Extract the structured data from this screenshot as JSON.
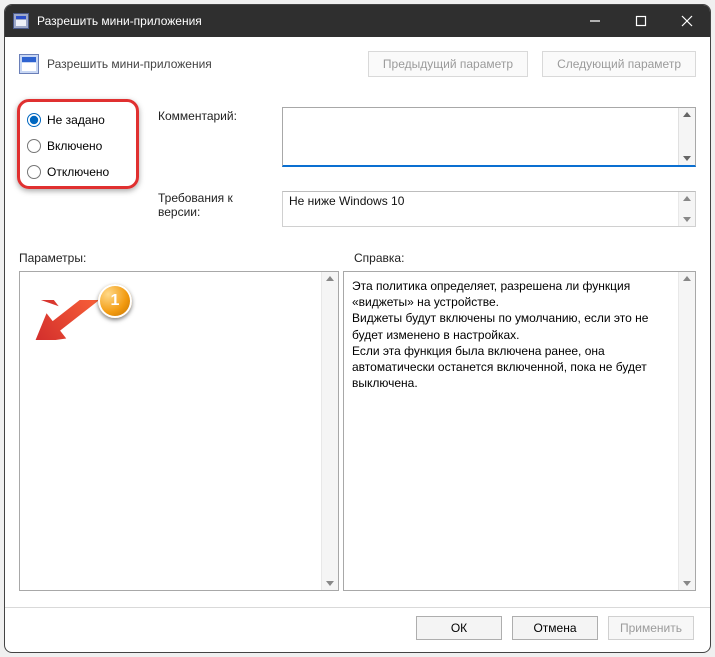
{
  "title": "Разрешить мини-приложения",
  "policyTitle": "Разрешить мини-приложения",
  "nav": {
    "prev": "Предыдущий параметр",
    "next": "Следующий параметр"
  },
  "radios": {
    "notset": "Не задано",
    "enabled": "Включено",
    "disabled": "Отключено"
  },
  "labels": {
    "comment": "Комментарий:",
    "version": "Требования к версии:",
    "params": "Параметры:",
    "help": "Справка:"
  },
  "comment": "",
  "versionText": "Не ниже Windows 10",
  "helpText": "Эта политика определяет, разрешена ли функция «виджеты» на устройстве.\nВиджеты будут включены по умолчанию, если это не будет изменено в настройках.\nЕсли эта функция была включена ранее, она автоматически останется включенной, пока не будет выключена.",
  "buttons": {
    "ok": "ОК",
    "cancel": "Отмена",
    "apply": "Применить"
  },
  "badge": "1"
}
